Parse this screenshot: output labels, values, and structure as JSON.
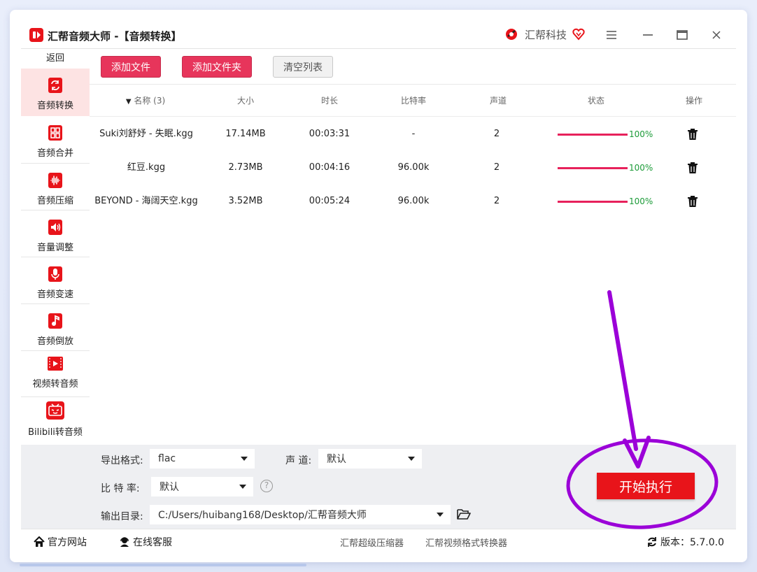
{
  "window": {
    "title": "汇帮音频大师 -【音频转换】",
    "brand": "汇帮科技"
  },
  "sidebar": {
    "back_label": "返回",
    "items": [
      {
        "label": "音频转换",
        "icon": "audio-convert-icon",
        "active": true
      },
      {
        "label": "音频合并",
        "icon": "audio-merge-icon"
      },
      {
        "label": "音频压缩",
        "icon": "audio-compress-icon"
      },
      {
        "label": "音量调整",
        "icon": "volume-adjust-icon"
      },
      {
        "label": "音频变速",
        "icon": "audio-speed-icon"
      },
      {
        "label": "音频倒放",
        "icon": "audio-reverse-icon"
      },
      {
        "label": "视频转音频",
        "icon": "video-to-audio-icon"
      },
      {
        "label": "Bilibili转音频",
        "icon": "bilibili-to-audio-icon"
      }
    ]
  },
  "toolbar": {
    "add_file": "添加文件",
    "add_folder": "添加文件夹",
    "clear_list": "清空列表"
  },
  "table": {
    "columns": [
      "名称 (3)",
      "大小",
      "时长",
      "比特率",
      "声道",
      "状态",
      "操作"
    ],
    "rows": [
      {
        "name": "Suki刘舒妤 - 失眠.kgg",
        "size": "17.14MB",
        "duration": "00:03:31",
        "bitrate": "-",
        "channels": "2",
        "progress": 1.0,
        "status": "100%"
      },
      {
        "name": "红豆.kgg",
        "size": "2.73MB",
        "duration": "00:04:16",
        "bitrate": "96.00k",
        "channels": "2",
        "progress": 1.0,
        "status": "100%"
      },
      {
        "name": "BEYOND - 海阔天空.kgg",
        "size": "3.52MB",
        "duration": "00:05:24",
        "bitrate": "96.00k",
        "channels": "2",
        "progress": 1.0,
        "status": "100%"
      }
    ]
  },
  "settings": {
    "format_label": "导出格式:",
    "format_value": "flac",
    "channel_label": "声 道:",
    "channel_value": "默认",
    "bitrate_label": "比 特 率:",
    "bitrate_value": "默认",
    "help": "?",
    "output_label": "输出目录:",
    "output_value": "C:/Users/huibang168/Desktop/汇帮音频大师",
    "start_button": "开始执行"
  },
  "footer": {
    "website": "官方网站",
    "service": "在线客服",
    "link1": "汇帮超级压缩器",
    "link2": "汇帮视频格式转换器",
    "version": "版本：5.7.0.0"
  },
  "colors": {
    "accent": "#e7355b",
    "start": "#e8141a",
    "progress": "#e7215b",
    "progress_text": "#1c9b38",
    "annotation": "#9b00d8"
  }
}
